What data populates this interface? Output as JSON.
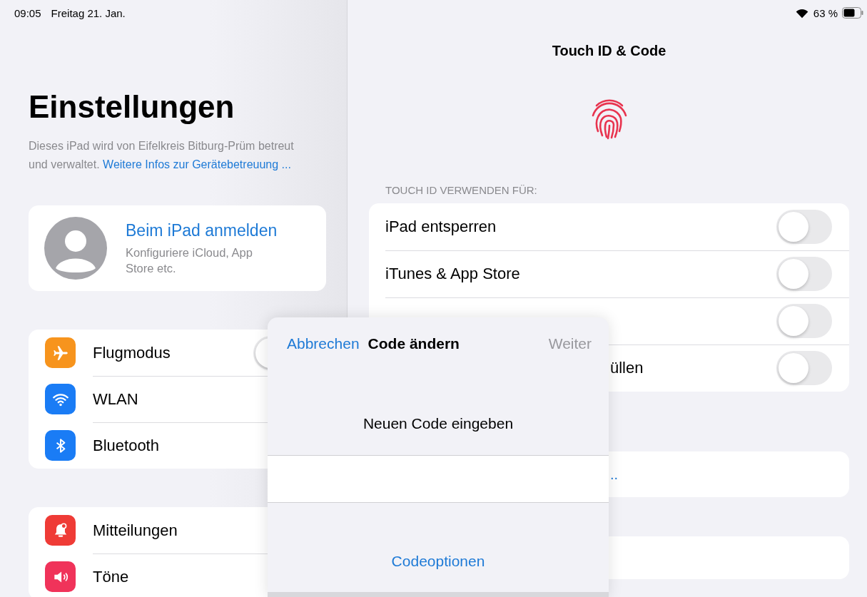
{
  "status_bar": {
    "time": "09:05",
    "date": "Freitag 21. Jan.",
    "battery": "63 %"
  },
  "sidebar": {
    "title": "Einstellungen",
    "notice": "Dieses iPad wird von Eifelkreis Bitburg-Prüm betreut und verwaltet.",
    "notice_link": "Weitere Infos zur Gerätebetreuung ...",
    "account": {
      "name": "Beim iPad anmelden",
      "subtitle": "Konfiguriere iCloud, App Store etc."
    },
    "groups": [
      [
        {
          "label": "Flugmodus",
          "kind": "airplane",
          "color": "#f7941d",
          "on": false
        },
        {
          "label": "WLAN",
          "kind": "wifi",
          "color": "#1a7cf5"
        },
        {
          "label": "Bluetooth",
          "kind": "bluetooth",
          "color": "#1a7cf5"
        }
      ],
      [
        {
          "label": "Mitteilungen",
          "kind": "bell",
          "color": "#ef3b36"
        },
        {
          "label": "Töne",
          "kind": "speaker",
          "color": "#f0335a"
        }
      ]
    ]
  },
  "detail": {
    "title": "Touch ID & Code",
    "section_header": "TOUCH ID VERWENDEN FÜR:",
    "rows": [
      {
        "label": "iPad entsperren",
        "kind": "full",
        "on": false
      },
      {
        "label": "iTunes & App Store",
        "kind": "full",
        "on": false
      },
      {
        "on": false
      },
      {
        "label": "üllen",
        "kind": "covered",
        "on": false
      }
    ],
    "link": ".."
  },
  "dialog": {
    "cancel": "Abbrechen",
    "title": "Code ändern",
    "next": "Weiter",
    "next_disabled": true,
    "prompt": "Neuen Code eingeben",
    "options": "Codeoptionen"
  }
}
